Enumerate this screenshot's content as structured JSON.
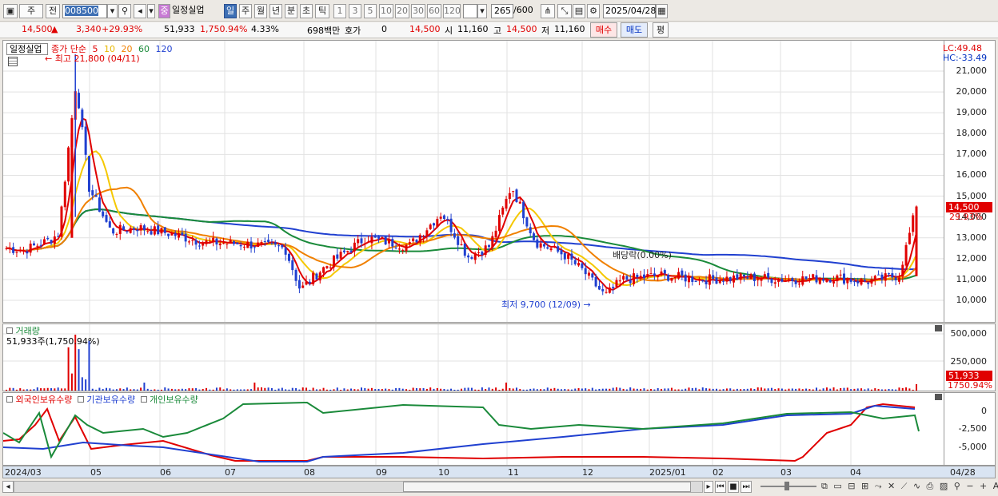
{
  "toolbar": {
    "market": "주",
    "flag": "전",
    "code": "008500",
    "stock_name": "일정실업",
    "stock_badge": "중",
    "periods": [
      "일",
      "주",
      "월",
      "년",
      "분",
      "초",
      "틱"
    ],
    "active_period": "일",
    "intervals": [
      "1",
      "3",
      "5",
      "10",
      "20",
      "30",
      "60",
      "120"
    ],
    "count": "265",
    "count_total": "/600",
    "date": "2025/04/28"
  },
  "quote": {
    "price": "14,500",
    "change": "3,340",
    "change_rate": "+29.93%",
    "volume": "51,933",
    "volume_rate": "1,750.94%",
    "turnover_rate": "4.33%",
    "amount": "698백만",
    "hoga_label": "호가",
    "hoga_value": "0",
    "hoga_price": "14,500",
    "open_label": "시",
    "open": "11,160",
    "high_label": "고",
    "high": "14,500",
    "low_label": "저",
    "low": "11,160",
    "buy_label": "매수",
    "sell_label": "매도",
    "extra_label": "평"
  },
  "price_panel": {
    "title": "일정실업",
    "ma_label": "종가 단순",
    "ma_periods": [
      "5",
      "10",
      "20",
      "60",
      "120"
    ],
    "ma_colors": [
      "#e00000",
      "#f5c800",
      "#f08000",
      "#1a8a3a",
      "#2040d0"
    ],
    "high_annotation": "최고 21,800 (04/11)",
    "low_annotation": "최저 9,700 (12/09)",
    "dividend_annotation": "배당락(0.00%)",
    "lc": "LC:49.48",
    "hc": "HC:-33.49",
    "current_price": "14,500",
    "current_change": "29.93%",
    "y_ticks": [
      "21,000",
      "20,000",
      "19,000",
      "18,000",
      "17,000",
      "16,000",
      "15,000",
      "14,000",
      "13,000",
      "12,000",
      "11,000",
      "10,000"
    ]
  },
  "volume_panel": {
    "title": "거래량",
    "value_label": "51,933주(1,750.94%)",
    "y_ticks": [
      "500,000",
      "250,000"
    ],
    "current_volume": "51,933",
    "current_rate": "1750.94%"
  },
  "holdings_panel": {
    "series": [
      "외국인보유수량",
      "기관보유수량",
      "개인보유수량"
    ],
    "series_colors": [
      "#e00000",
      "#2040d0",
      "#1a8a3a"
    ],
    "y_ticks": [
      "0",
      "-2,500",
      "-5,000"
    ]
  },
  "date_axis": {
    "labels": [
      "2024/03",
      "05",
      "06",
      "07",
      "08",
      "09",
      "10",
      "11",
      "12",
      "2025/01",
      "02",
      "03",
      "04"
    ],
    "right_label": "04/28"
  },
  "chart_data": {
    "type": "line",
    "title": "",
    "x": [
      "2024/03",
      "05",
      "06",
      "07",
      "08",
      "09",
      "10",
      "11",
      "12",
      "2025/01",
      "02",
      "03",
      "04"
    ],
    "series": [
      {
        "name": "종가",
        "values": [
          12800,
          13300,
          13100,
          12600,
          12700,
          12900,
          13400,
          15200,
          10000,
          11100,
          10900,
          11000,
          11000,
          14500
        ]
      }
    ],
    "ylim": [
      9500,
      21800
    ],
    "high": {
      "value": 21800,
      "date": "04/11"
    },
    "low": {
      "value": 9700,
      "date": "12/09"
    }
  }
}
